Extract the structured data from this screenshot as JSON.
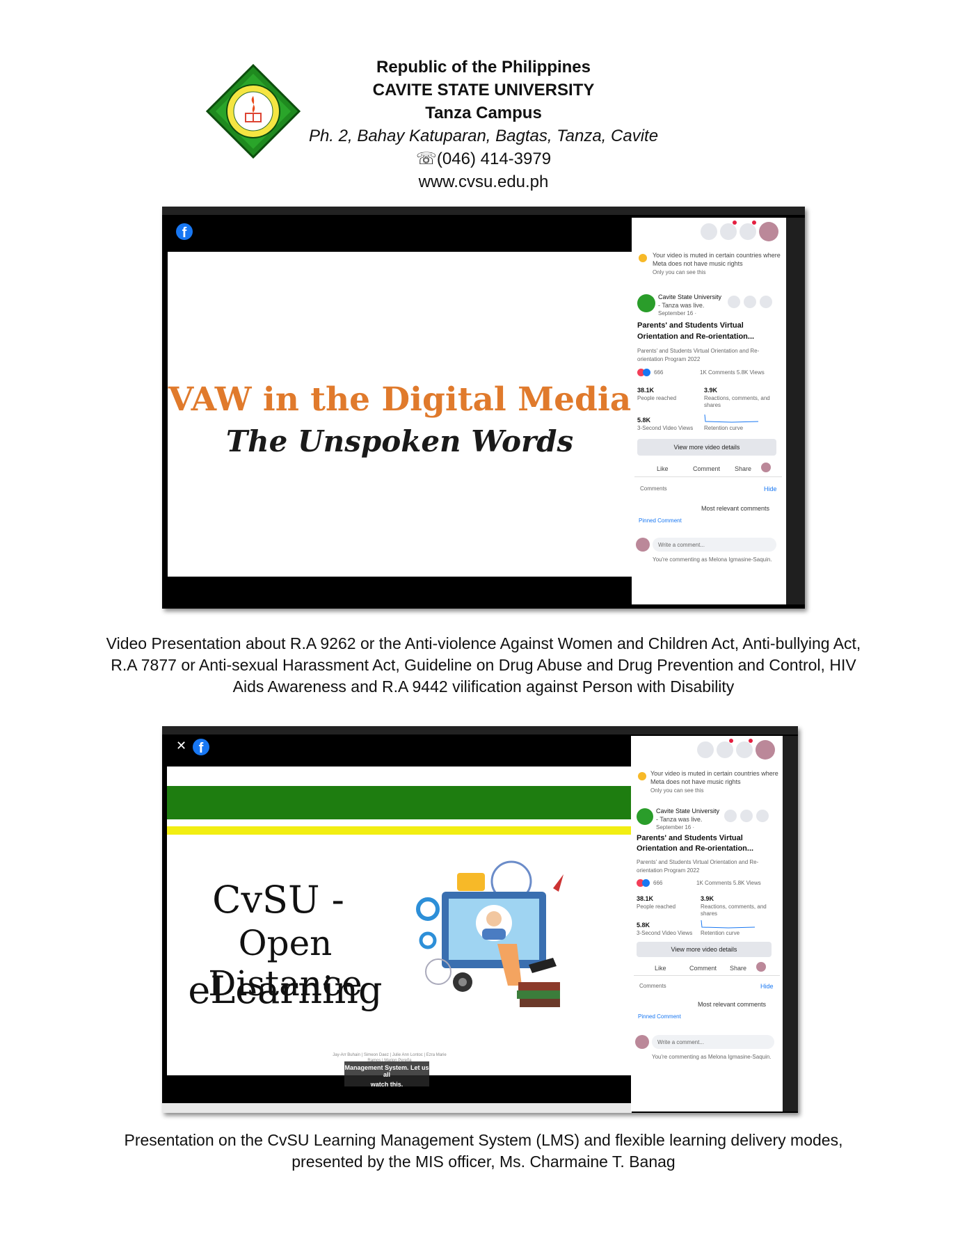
{
  "header": {
    "line1": "Republic of the Philippines",
    "line2": "CAVITE STATE UNIVERSITY",
    "line3": "Tanza Campus",
    "address": "Ph. 2, Bahay Katuparan, Bagtas, Tanza, Cavite",
    "phone": "☏(046) 414-3979",
    "website": "www.cvsu.edu.ph"
  },
  "logo": {
    "icon": "university-seal-icon",
    "text": "CAVITE STATE UNIVERSITY"
  },
  "shot1": {
    "video_title": "VAW in the Digital Media",
    "video_subtitle": "The Unspoken Words",
    "title_color": "#e07a2c",
    "caption": "Video Presentation about R.A 9262 or the Anti-violence Against Women and Children Act, Anti-bullying Act, R.A 7877 or Anti-sexual Harassment Act, Guideline on Drug Abuse and Drug Prevention and Control, HIV Aids Awareness and R.A 9442 vilification against Person with Disability"
  },
  "shot2": {
    "slide_line1": "CvSU -",
    "slide_line2": "Open Distance",
    "slide_line3": "eLearning",
    "credits_line1": "Jay-Arr Buhain | Simeon Daez | Julie Ann Lontoc | Ezra Marie",
    "credits_line2": "Ramos | Marion Pereña",
    "subtitle_line1": "Management System. Let us all",
    "subtitle_line2": "watch this.",
    "green": "#1e7d10",
    "yellow": "#f2ee12",
    "caption": "Presentation on the CvSU Learning Management System (LMS) and flexible learning delivery modes, presented by the MIS officer, Ms. Charmaine T. Banag"
  },
  "panel": {
    "notice1": "Your video is muted in certain countries where",
    "notice2": "Meta does not have music rights",
    "notice3": "Only you can see this",
    "page_name1": "Cavite State University",
    "page_name2": "- Tanza was live.",
    "page_date": "September 16 · ",
    "post_title1": "Parents' and Students Virtual",
    "post_title2": "Orientation and Re-orientation...",
    "post_desc1": "Parents' and Students Virtual Orientation and Re-",
    "post_desc2": "orientation Program 2022",
    "reactions": "666",
    "comments_views": "1K Comments  5.8K Views",
    "reached_value": "38.1K",
    "reached_label": "People reached",
    "engage_value": "3.9K",
    "engage_label1": "Reactions, comments, and",
    "engage_label2": "shares",
    "views3s_value": "5.8K",
    "views3s_label": "3-Second Video Views",
    "retention_label": "Retention curve",
    "details_button": "View more video details",
    "like": "Like",
    "comment": "Comment",
    "share": "Share",
    "comments_label": "Comments",
    "hide": "Hide",
    "sort": "Most relevant comments",
    "pinned": "Pinned Comment",
    "write_placeholder": "Write a comment...",
    "commenting_as": "You're commenting as Melona Igmasine-Saquin."
  }
}
